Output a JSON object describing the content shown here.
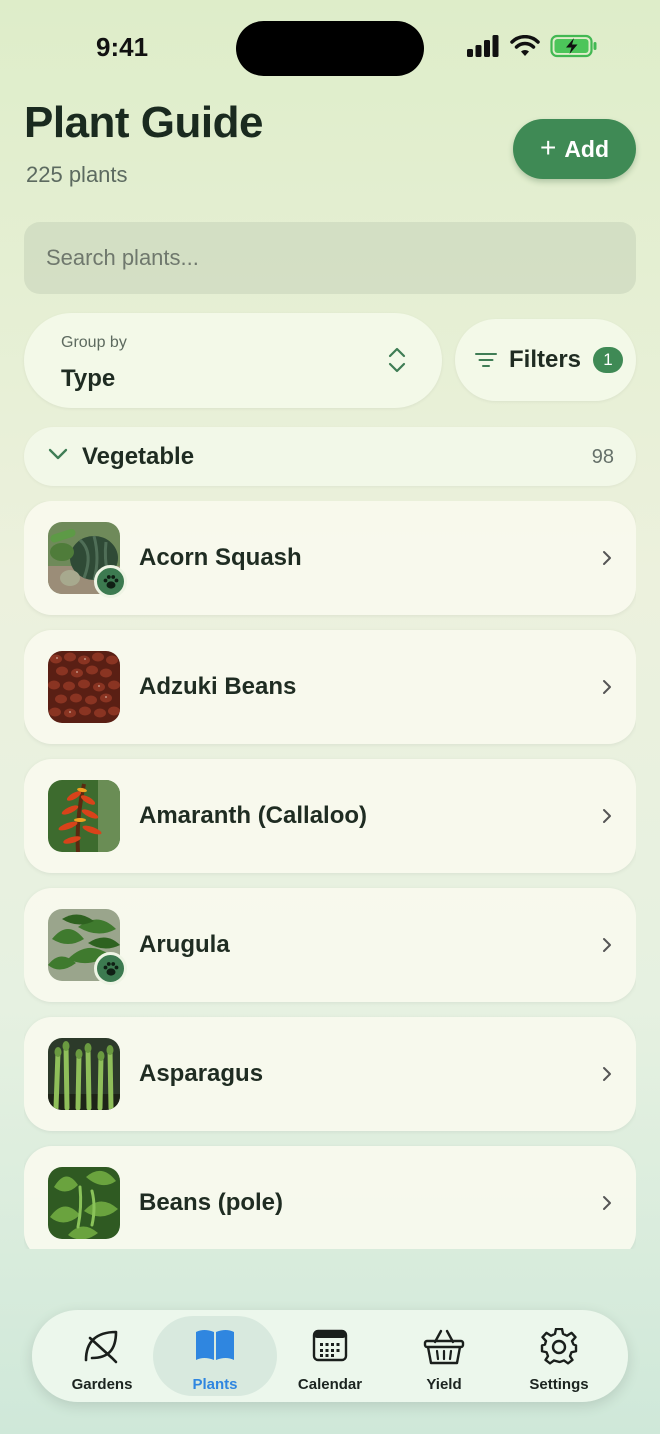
{
  "status_bar": {
    "time": "9:41"
  },
  "header": {
    "title": "Plant Guide",
    "count": "225 plants",
    "add_label": "Add"
  },
  "search": {
    "placeholder": "Search plants..."
  },
  "group_by": {
    "label": "Group by",
    "value": "Type"
  },
  "filters": {
    "label": "Filters",
    "badge": "1"
  },
  "section": {
    "title": "Vegetable",
    "count": "98"
  },
  "plants": [
    {
      "name": "Acorn Squash",
      "pet_badge": true
    },
    {
      "name": "Adzuki Beans",
      "pet_badge": false
    },
    {
      "name": "Amaranth (Callaloo)",
      "pet_badge": false
    },
    {
      "name": "Arugula",
      "pet_badge": true
    },
    {
      "name": "Asparagus",
      "pet_badge": false
    },
    {
      "name": "Beans (pole)",
      "pet_badge": false
    }
  ],
  "tabs": [
    {
      "label": "Gardens",
      "icon": "leaf-icon",
      "active": false
    },
    {
      "label": "Plants",
      "icon": "book-icon",
      "active": true
    },
    {
      "label": "Calendar",
      "icon": "calendar-icon",
      "active": false
    },
    {
      "label": "Yield",
      "icon": "basket-icon",
      "active": false
    },
    {
      "label": "Settings",
      "icon": "gear-icon",
      "active": false
    }
  ],
  "colors": {
    "accent": "#3f8a55",
    "active_tab": "#2f86e0"
  }
}
